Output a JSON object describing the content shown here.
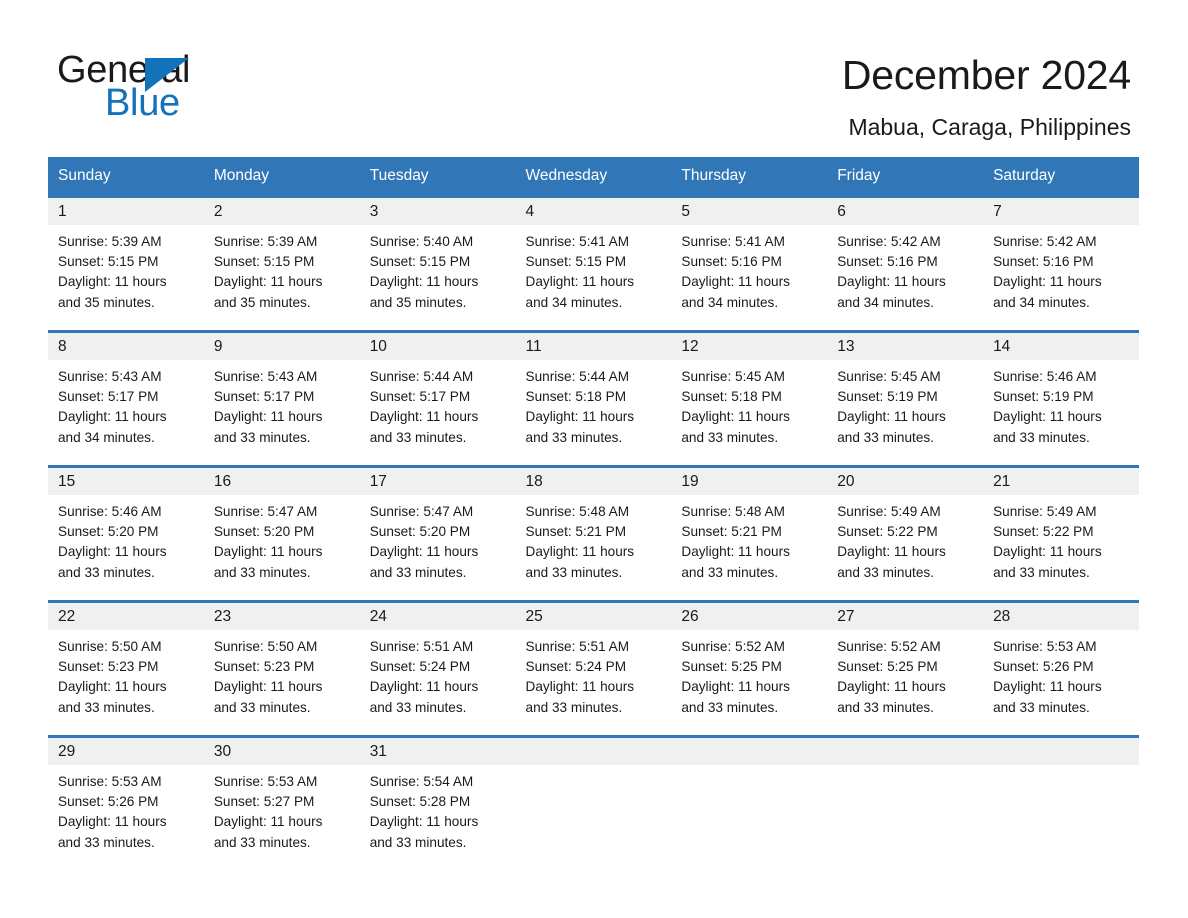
{
  "logo": {
    "word_one": "General",
    "word_two": "Blue",
    "triangle_icon": "triangle-icon",
    "brand_blue": "#1273ba"
  },
  "header": {
    "title": "December 2024",
    "subtitle": "Mabua, Caraga, Philippines"
  },
  "colors": {
    "header_blue": "#3177b8",
    "daynum_band": "#f0f0f0",
    "text": "#1a1a1a"
  },
  "weekday_headers": [
    "Sunday",
    "Monday",
    "Tuesday",
    "Wednesday",
    "Thursday",
    "Friday",
    "Saturday"
  ],
  "weeks": [
    [
      {
        "day": "1",
        "info": "Sunrise: 5:39 AM\nSunset: 5:15 PM\nDaylight: 11 hours\nand 35 minutes."
      },
      {
        "day": "2",
        "info": "Sunrise: 5:39 AM\nSunset: 5:15 PM\nDaylight: 11 hours\nand 35 minutes."
      },
      {
        "day": "3",
        "info": "Sunrise: 5:40 AM\nSunset: 5:15 PM\nDaylight: 11 hours\nand 35 minutes."
      },
      {
        "day": "4",
        "info": "Sunrise: 5:41 AM\nSunset: 5:15 PM\nDaylight: 11 hours\nand 34 minutes."
      },
      {
        "day": "5",
        "info": "Sunrise: 5:41 AM\nSunset: 5:16 PM\nDaylight: 11 hours\nand 34 minutes."
      },
      {
        "day": "6",
        "info": "Sunrise: 5:42 AM\nSunset: 5:16 PM\nDaylight: 11 hours\nand 34 minutes."
      },
      {
        "day": "7",
        "info": "Sunrise: 5:42 AM\nSunset: 5:16 PM\nDaylight: 11 hours\nand 34 minutes."
      }
    ],
    [
      {
        "day": "8",
        "info": "Sunrise: 5:43 AM\nSunset: 5:17 PM\nDaylight: 11 hours\nand 34 minutes."
      },
      {
        "day": "9",
        "info": "Sunrise: 5:43 AM\nSunset: 5:17 PM\nDaylight: 11 hours\nand 33 minutes."
      },
      {
        "day": "10",
        "info": "Sunrise: 5:44 AM\nSunset: 5:17 PM\nDaylight: 11 hours\nand 33 minutes."
      },
      {
        "day": "11",
        "info": "Sunrise: 5:44 AM\nSunset: 5:18 PM\nDaylight: 11 hours\nand 33 minutes."
      },
      {
        "day": "12",
        "info": "Sunrise: 5:45 AM\nSunset: 5:18 PM\nDaylight: 11 hours\nand 33 minutes."
      },
      {
        "day": "13",
        "info": "Sunrise: 5:45 AM\nSunset: 5:19 PM\nDaylight: 11 hours\nand 33 minutes."
      },
      {
        "day": "14",
        "info": "Sunrise: 5:46 AM\nSunset: 5:19 PM\nDaylight: 11 hours\nand 33 minutes."
      }
    ],
    [
      {
        "day": "15",
        "info": "Sunrise: 5:46 AM\nSunset: 5:20 PM\nDaylight: 11 hours\nand 33 minutes."
      },
      {
        "day": "16",
        "info": "Sunrise: 5:47 AM\nSunset: 5:20 PM\nDaylight: 11 hours\nand 33 minutes."
      },
      {
        "day": "17",
        "info": "Sunrise: 5:47 AM\nSunset: 5:20 PM\nDaylight: 11 hours\nand 33 minutes."
      },
      {
        "day": "18",
        "info": "Sunrise: 5:48 AM\nSunset: 5:21 PM\nDaylight: 11 hours\nand 33 minutes."
      },
      {
        "day": "19",
        "info": "Sunrise: 5:48 AM\nSunset: 5:21 PM\nDaylight: 11 hours\nand 33 minutes."
      },
      {
        "day": "20",
        "info": "Sunrise: 5:49 AM\nSunset: 5:22 PM\nDaylight: 11 hours\nand 33 minutes."
      },
      {
        "day": "21",
        "info": "Sunrise: 5:49 AM\nSunset: 5:22 PM\nDaylight: 11 hours\nand 33 minutes."
      }
    ],
    [
      {
        "day": "22",
        "info": "Sunrise: 5:50 AM\nSunset: 5:23 PM\nDaylight: 11 hours\nand 33 minutes."
      },
      {
        "day": "23",
        "info": "Sunrise: 5:50 AM\nSunset: 5:23 PM\nDaylight: 11 hours\nand 33 minutes."
      },
      {
        "day": "24",
        "info": "Sunrise: 5:51 AM\nSunset: 5:24 PM\nDaylight: 11 hours\nand 33 minutes."
      },
      {
        "day": "25",
        "info": "Sunrise: 5:51 AM\nSunset: 5:24 PM\nDaylight: 11 hours\nand 33 minutes."
      },
      {
        "day": "26",
        "info": "Sunrise: 5:52 AM\nSunset: 5:25 PM\nDaylight: 11 hours\nand 33 minutes."
      },
      {
        "day": "27",
        "info": "Sunrise: 5:52 AM\nSunset: 5:25 PM\nDaylight: 11 hours\nand 33 minutes."
      },
      {
        "day": "28",
        "info": "Sunrise: 5:53 AM\nSunset: 5:26 PM\nDaylight: 11 hours\nand 33 minutes."
      }
    ],
    [
      {
        "day": "29",
        "info": "Sunrise: 5:53 AM\nSunset: 5:26 PM\nDaylight: 11 hours\nand 33 minutes."
      },
      {
        "day": "30",
        "info": "Sunrise: 5:53 AM\nSunset: 5:27 PM\nDaylight: 11 hours\nand 33 minutes."
      },
      {
        "day": "31",
        "info": "Sunrise: 5:54 AM\nSunset: 5:28 PM\nDaylight: 11 hours\nand 33 minutes."
      },
      {
        "day": "",
        "info": ""
      },
      {
        "day": "",
        "info": ""
      },
      {
        "day": "",
        "info": ""
      },
      {
        "day": "",
        "info": ""
      }
    ]
  ]
}
